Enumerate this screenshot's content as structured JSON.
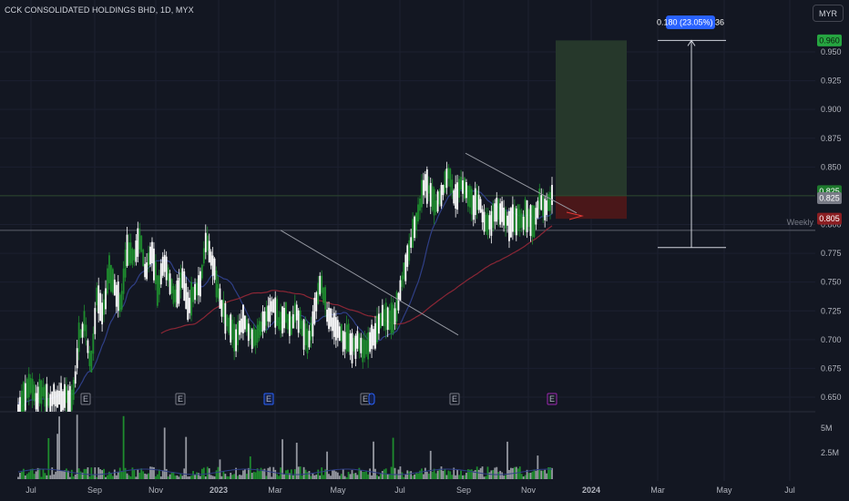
{
  "header": {
    "symbol": "CCK CONSOLIDATED HOLDINGS BHD",
    "interval": "1D",
    "exchange": "MYX",
    "currency_button": "MYR"
  },
  "colors": {
    "background": "#131722",
    "up": "#ffffff",
    "down": "#1e8c2e",
    "ma_short": "#2f3f86",
    "ma_long": "#8a2635",
    "target_zone": "#26382b",
    "stop_zone": "#4a1719",
    "grid": "#1c2030",
    "axis_text": "#b2b5be",
    "badge_green": "#26a641",
    "badge_gray": "#787b86",
    "badge_red": "#8b1e22",
    "measure_blue": "#2962ff",
    "earnings_purple": "#9c27b0"
  },
  "chart_data": {
    "type": "candlestick",
    "price_axis": {
      "ticks": [
        "0.950",
        "0.925",
        "0.900",
        "0.875",
        "0.850",
        "0.825",
        "0.800",
        "0.775",
        "0.750",
        "0.725",
        "0.700",
        "0.675",
        "0.650"
      ],
      "range": [
        0.642,
        0.975
      ]
    },
    "volume_axis": {
      "ticks": [
        "5M",
        "2.5M"
      ]
    },
    "time_axis": {
      "labels": [
        "Jul",
        "Sep",
        "Nov",
        "2023",
        "Mar",
        "May",
        "Jul",
        "Sep",
        "Nov",
        "2024",
        "Mar",
        "May",
        "Jul"
      ]
    },
    "price_badges": [
      {
        "label": "0.960",
        "value": 0.96,
        "kind": "target"
      },
      {
        "label": "0.825",
        "value": 0.829,
        "kind": "last"
      },
      {
        "label": "0.825",
        "value": 0.823,
        "kind": "close"
      },
      {
        "label": "0.805",
        "value": 0.805,
        "kind": "stop"
      }
    ],
    "weekly_label": "Weekly",
    "measure_label": "0.180 (23.05%) 36",
    "measure_range": [
      0.78,
      0.96
    ],
    "trade_setup": {
      "entry": 0.825,
      "target": 0.96,
      "stop": 0.805
    },
    "weekly_level": 0.795,
    "earnings_markers": [
      {
        "label": "E",
        "date": "2022-10",
        "style": "gray"
      },
      {
        "label": "E",
        "date": "2022-12",
        "style": "gray"
      },
      {
        "label": "E",
        "date": "2023-03",
        "style": "blue"
      },
      {
        "label": "E",
        "date": "2023-06",
        "style": "gray-split"
      },
      {
        "label": "E",
        "date": "2023-08",
        "style": "gray"
      },
      {
        "label": "E",
        "date": "2023-11",
        "style": "purple"
      }
    ],
    "trendlines": [
      {
        "from": [
          "2023-02-20",
          0.795
        ],
        "to": [
          "2023-08-01",
          0.705
        ]
      },
      {
        "from": [
          "2023-09-01",
          0.86
        ],
        "to": [
          "2023-11-20",
          0.812
        ]
      }
    ],
    "price_path": [
      [
        0.64,
        0.64
      ],
      [
        0.65,
        0.65
      ],
      [
        0.66,
        0.66
      ],
      [
        0.648,
        0.648
      ],
      [
        0.655,
        0.655
      ],
      [
        0.645,
        0.645
      ],
      [
        0.65,
        0.65
      ],
      [
        0.648,
        0.648
      ],
      [
        0.652,
        0.652
      ],
      [
        0.645,
        0.645
      ],
      [
        0.7,
        0.7
      ],
      [
        0.715,
        0.715
      ],
      [
        0.675,
        0.675
      ],
      [
        0.74,
        0.74
      ],
      [
        0.72,
        0.72
      ],
      [
        0.76,
        0.76
      ],
      [
        0.745,
        0.745
      ],
      [
        0.73,
        0.73
      ],
      [
        0.78,
        0.78
      ],
      [
        0.77,
        0.77
      ],
      [
        0.79,
        0.79
      ],
      [
        0.76,
        0.76
      ],
      [
        0.78,
        0.78
      ],
      [
        0.74,
        0.74
      ],
      [
        0.77,
        0.77
      ],
      [
        0.75,
        0.75
      ],
      [
        0.735,
        0.735
      ],
      [
        0.755,
        0.755
      ],
      [
        0.73,
        0.73
      ],
      [
        0.74,
        0.74
      ],
      [
        0.75,
        0.75
      ],
      [
        0.785,
        0.785
      ],
      [
        0.77,
        0.77
      ],
      [
        0.74,
        0.74
      ],
      [
        0.72,
        0.72
      ],
      [
        0.71,
        0.71
      ],
      [
        0.7,
        0.7
      ],
      [
        0.72,
        0.72
      ],
      [
        0.705,
        0.705
      ],
      [
        0.7,
        0.7
      ],
      [
        0.71,
        0.71
      ],
      [
        0.72,
        0.72
      ],
      [
        0.73,
        0.73
      ],
      [
        0.715,
        0.715
      ],
      [
        0.72,
        0.72
      ],
      [
        0.71,
        0.71
      ],
      [
        0.725,
        0.725
      ],
      [
        0.705,
        0.705
      ],
      [
        0.7,
        0.7
      ],
      [
        0.73,
        0.73
      ],
      [
        0.75,
        0.75
      ],
      [
        0.72,
        0.72
      ],
      [
        0.715,
        0.715
      ],
      [
        0.705,
        0.705
      ],
      [
        0.7,
        0.7
      ],
      [
        0.695,
        0.695
      ],
      [
        0.7,
        0.7
      ],
      [
        0.69,
        0.69
      ],
      [
        0.7,
        0.7
      ],
      [
        0.705,
        0.705
      ],
      [
        0.72,
        0.72
      ],
      [
        0.715,
        0.715
      ],
      [
        0.72,
        0.72
      ],
      [
        0.74,
        0.74
      ],
      [
        0.77,
        0.77
      ],
      [
        0.79,
        0.79
      ],
      [
        0.81,
        0.81
      ],
      [
        0.84,
        0.84
      ],
      [
        0.825,
        0.825
      ],
      [
        0.815,
        0.815
      ],
      [
        0.83,
        0.83
      ],
      [
        0.845,
        0.845
      ],
      [
        0.82,
        0.82
      ],
      [
        0.835,
        0.835
      ],
      [
        0.83,
        0.83
      ],
      [
        0.815,
        0.815
      ],
      [
        0.82,
        0.82
      ],
      [
        0.8,
        0.8
      ],
      [
        0.805,
        0.805
      ],
      [
        0.815,
        0.815
      ],
      [
        0.81,
        0.81
      ],
      [
        0.8,
        0.8
      ],
      [
        0.805,
        0.805
      ],
      [
        0.8,
        0.8
      ],
      [
        0.81,
        0.81
      ],
      [
        0.8,
        0.8
      ],
      [
        0.82,
        0.82
      ],
      [
        0.815,
        0.815
      ],
      [
        0.825,
        0.825
      ]
    ]
  }
}
